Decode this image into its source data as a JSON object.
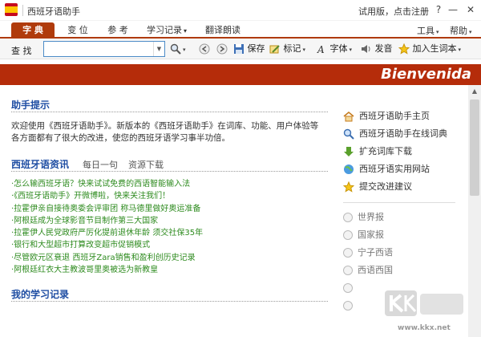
{
  "window": {
    "title": "西班牙语助手",
    "trial_text": "试用版，点击注册",
    "help_btn": "?",
    "min_btn": "—",
    "max_btn": "☐",
    "close_btn": "✕"
  },
  "tabs": [
    {
      "label": "字 典"
    },
    {
      "label": "变 位"
    },
    {
      "label": "参 考"
    },
    {
      "label": "学习记录"
    },
    {
      "label": "翻译朗读"
    }
  ],
  "menus": {
    "tools": "工具",
    "help": "帮助"
  },
  "toolbar": {
    "find_label": "查 找",
    "search_value": "",
    "save": "保存",
    "mark": "标记",
    "font": "字体",
    "speak": "发音",
    "add_vocab": "加入生词本"
  },
  "banner": {
    "text": "Bienvenida"
  },
  "tips": {
    "title": "助手提示",
    "body": "欢迎使用《西班牙语助手》。新版本的《西班牙语助手》在词库、功能、用户体验等各方面都有了很大的改进，使您的西班牙语学习事半功倍。"
  },
  "news": {
    "title": "西班牙语资讯",
    "tabs": [
      "每日一句",
      "资源下载"
    ],
    "items": [
      "·怎么输西班牙语？快来试试免费的西语智能输入法",
      "·《西班牙语助手》开微博啦，快来关注我们！",
      "·拉霍伊亲自接待奥委会评审团 称马德里做好奥运准备",
      "·阿根廷成为全球影音节目制作第三大国家",
      "·拉霍伊人民党政府严厉化提前退休年龄 须交社保35年",
      "·银行和大型超市打算改变超市促销模式",
      "·尽管欧元区衰退 西班牙Zara销售和盈利创历史记录",
      "·阿根廷红衣大主教波哥里奥被选为新教皇"
    ]
  },
  "records": {
    "title": "我的学习记录"
  },
  "sidebar": {
    "links": [
      {
        "label": "西班牙语助手主页",
        "icon": "home-icon"
      },
      {
        "label": "西班牙语助手在线词典",
        "icon": "magnifier-icon"
      },
      {
        "label": "扩充词库下载",
        "icon": "download-arrow-icon"
      },
      {
        "label": "西班牙语实用网站",
        "icon": "globe-icon"
      },
      {
        "label": "提交改进建议",
        "icon": "star-icon"
      }
    ],
    "papers": [
      "世界报",
      "国家报",
      "宁子西语",
      "西语西国"
    ]
  },
  "watermark": {
    "text": "www.kkx.net"
  },
  "colors": {
    "accent": "#b52c0a",
    "link": "#1f4ea3",
    "news": "#2e8b1f"
  }
}
